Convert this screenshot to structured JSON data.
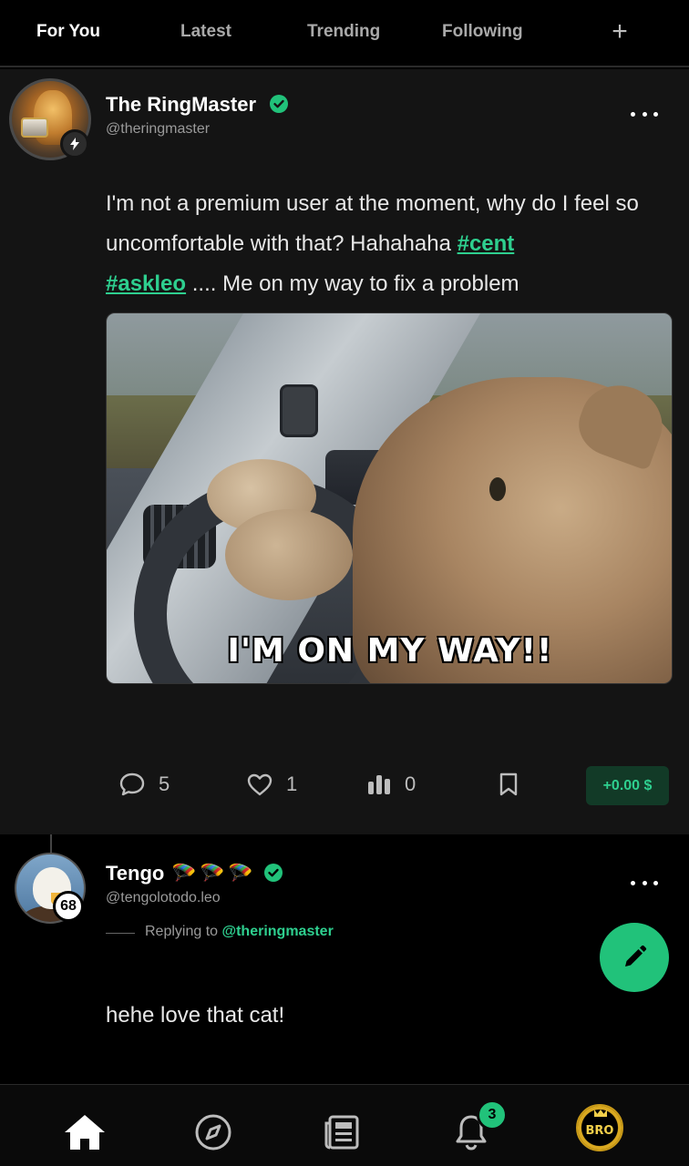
{
  "tabs": [
    {
      "label": "For You",
      "active": true
    },
    {
      "label": "Latest",
      "active": false
    },
    {
      "label": "Trending",
      "active": false
    },
    {
      "label": "Following",
      "active": false
    }
  ],
  "tab_add_label": "+",
  "post": {
    "author_name": "The RingMaster",
    "author_handle": "@theringmaster",
    "text_1": "I'm not a premium user at the moment, why do I feel so uncomfortable with that? Hahahaha ",
    "hashtag_1": "#cent",
    "hashtag_2": "#askleo",
    "text_2": " .... Me on my way to fix a problem",
    "media_caption": "I'M ON MY WAY!!",
    "comments": "5",
    "likes": "1",
    "views": "0",
    "tip": "+0.00 $"
  },
  "reply": {
    "author_name": "Tengo",
    "author_emojis": [
      "🪂",
      "🪂",
      "🪂"
    ],
    "author_handle": "@tengolotodo.leo",
    "level": "68",
    "replying_to_label": "Replying to ",
    "replying_to_handle": "@theringmaster",
    "text": "hehe love that cat!"
  },
  "nav": {
    "notification_count": "3",
    "brand_badge": "BRO"
  },
  "colors": {
    "accent": "#21c27a",
    "link": "#2ecf8f",
    "background": "#000000",
    "card": "#141414"
  }
}
